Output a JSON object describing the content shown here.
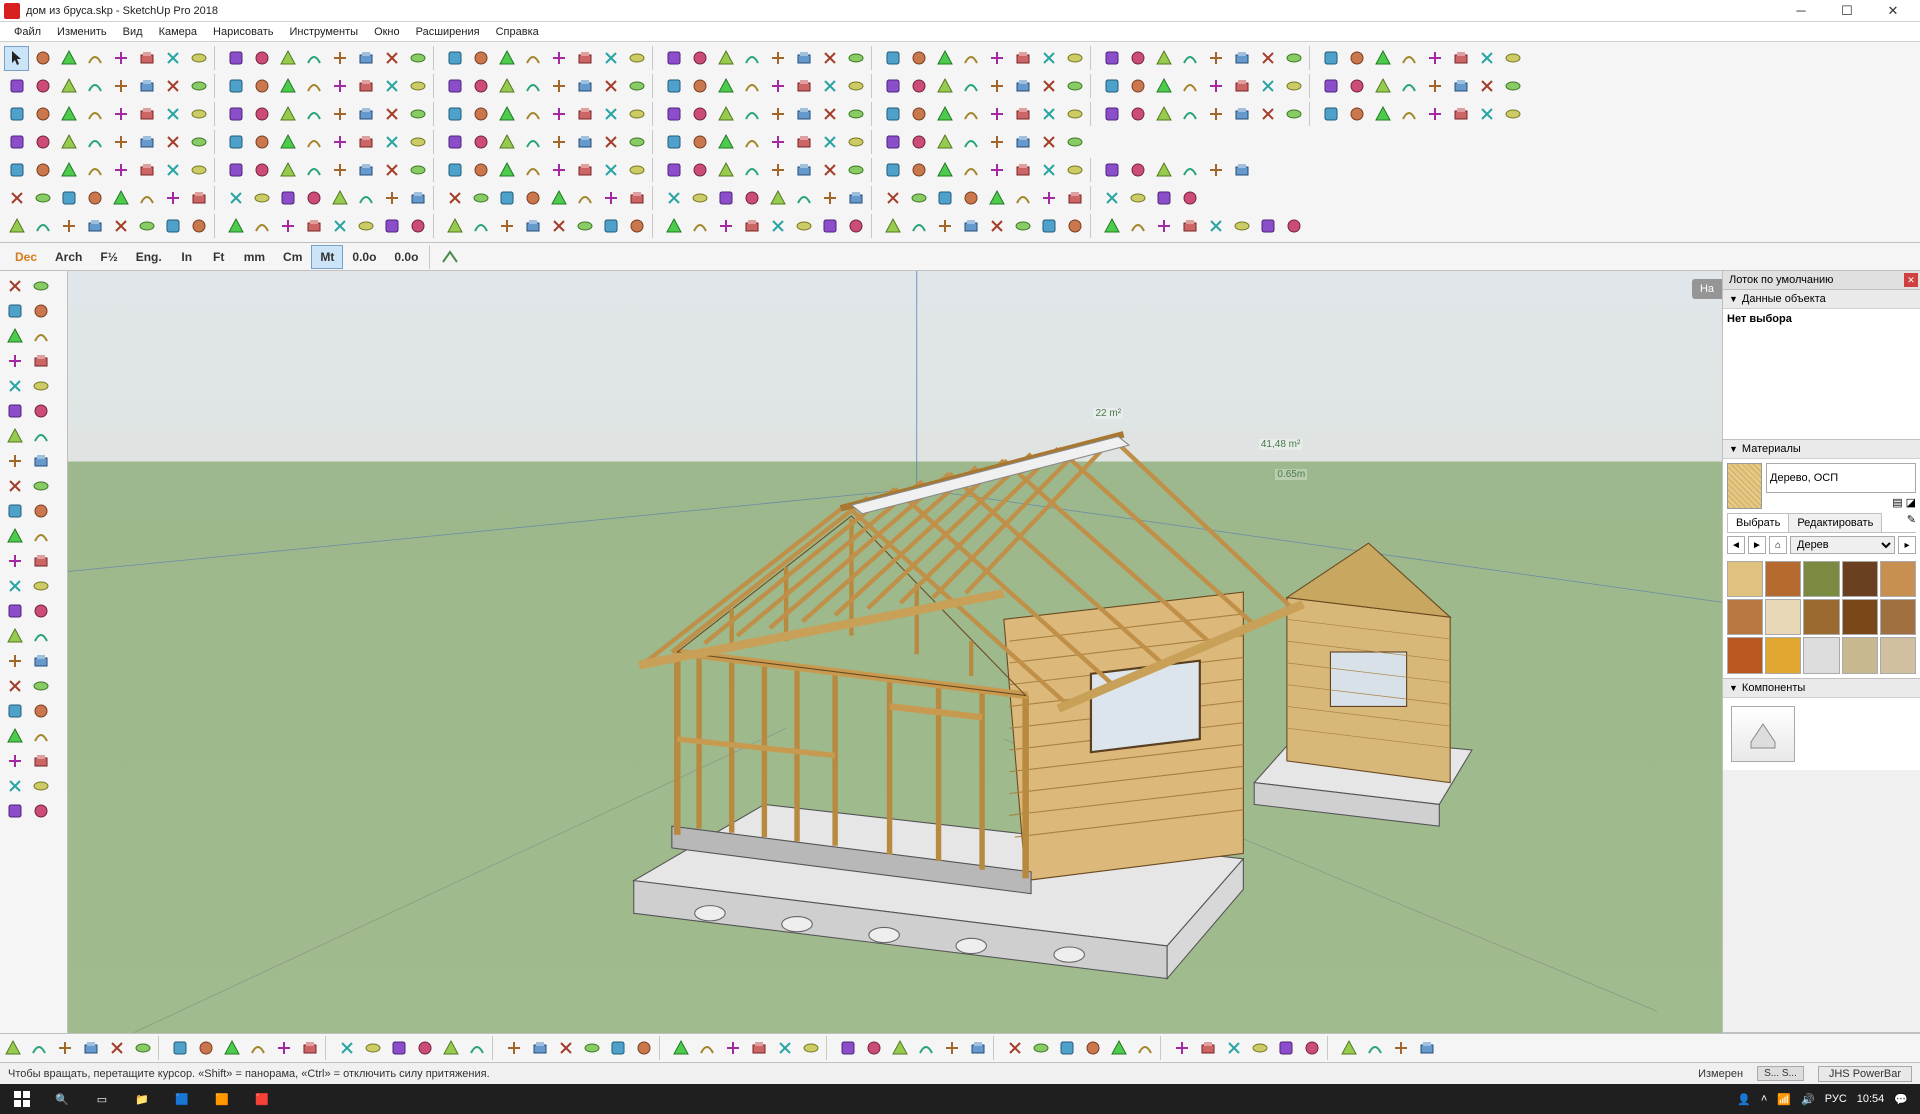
{
  "title": "дом из бруса.skp - SketchUp Pro 2018",
  "menubar": [
    "Файл",
    "Изменить",
    "Вид",
    "Камера",
    "Нарисовать",
    "Инструменты",
    "Окно",
    "Расширения",
    "Справка"
  ],
  "units_bar": {
    "items": [
      "Dec",
      "Arch",
      "F½",
      "Eng.",
      "In",
      "Ft",
      "mm",
      "Cm",
      "Mt",
      "0.0o",
      "0.0o"
    ],
    "active": "Mt"
  },
  "right_panel": {
    "tray_title": "Лоток по умолчанию",
    "entity_info": {
      "title": "Данные объекта",
      "body": "Нет выбора"
    },
    "materials": {
      "title": "Материалы",
      "current_name": "Дерево, ОСП",
      "tabs": [
        "Выбрать",
        "Редактировать"
      ],
      "active_tab": "Выбрать",
      "dropdown": "Дерев",
      "swatches": [
        "#e0c280",
        "#b56a30",
        "#7a8a40",
        "#6a4020",
        "#c89050",
        "#b87840",
        "#e8d8b8",
        "#9a6a30",
        "#7a4818",
        "#a07040",
        "#b85820",
        "#e0a830",
        "#ddd",
        "#c8b890",
        "#d0c0a0"
      ]
    },
    "components": {
      "title": "Компоненты"
    }
  },
  "statusbar": {
    "hint": "Чтобы вращать, перетащите курсор. «Shift» = панорама, «Ctrl» = отключить силу притяжения.",
    "measure_label": "Измерен",
    "powerbar": "JHS PowerBar"
  },
  "viewport": {
    "nas_label": "На",
    "annot1": "22 m²",
    "annot2": "41,48 m²",
    "annot3": "0.65m"
  },
  "taskbar": {
    "lang": "РУС",
    "time": "10:54"
  },
  "toolbar_icons": {
    "row1": [
      "cursor",
      "pencil",
      "eraser",
      "line",
      "arc1",
      "arc2",
      "rect",
      "shapes",
      "rotate1",
      "rotate2",
      "rotate3",
      "pushpull",
      "offset",
      "move-copy",
      "rotate-copy",
      "scale",
      "tape",
      "protractor",
      "text",
      "axis",
      "dim",
      "section",
      "zoom",
      "zoom-ext",
      "zoom-win",
      "orbit",
      "pan",
      "look",
      "walk",
      "position",
      "undo",
      "redo",
      "paint",
      "select-all",
      "lasso",
      "grp",
      "comp",
      "hide",
      "unhide",
      "lock",
      "eye1",
      "eye2",
      "flip1",
      "flip2",
      "flip3",
      "flip4",
      "flip5",
      "align",
      "curve1",
      "curve2",
      "curve3",
      "curve4",
      "curve5",
      "arc-a",
      "arc-b",
      "arc-c",
      "arc-d",
      "arc-e",
      "arc-f",
      "arc-g",
      "gear"
    ],
    "row2": [
      "v1",
      "v2",
      "v3",
      "v4",
      "v5",
      "v6",
      "v7",
      "poly1",
      "poly2",
      "sq1",
      "sq2",
      "sq3",
      "sq4",
      "sq5",
      "bld1",
      "bld2",
      "bld3",
      "bld4",
      "bld5",
      "bld6",
      "bld7",
      "bld8",
      "bld9",
      "bld10",
      "bld11",
      "bld12",
      "wall1",
      "wall2",
      "wall3",
      "wall4",
      "wall5",
      "wall6",
      "wall7",
      "roof1",
      "roof2",
      "roof3",
      "roof4",
      "roof5",
      "roof6",
      "roof7",
      "roof8",
      "grn1",
      "grn2",
      "grn3",
      "stair1",
      "stair2",
      "stair3",
      "circ1",
      "circ2",
      "circ3",
      "circ4",
      "circ5",
      "circ6",
      "circ7",
      "circ8",
      "sph1",
      "sph2",
      "sph3",
      "sph4",
      "sph5",
      "sph6",
      "sph7",
      "sph8",
      "sph9",
      "hand",
      "settings"
    ],
    "left_col_icons": [
      "lc1",
      "lc2",
      "lc3",
      "lc4",
      "lc5",
      "lc6",
      "lc7",
      "lc8",
      "lc9",
      "lc10",
      "lc11",
      "lc12",
      "lc13",
      "lc14",
      "lc15",
      "lc16",
      "lc17",
      "lc18",
      "lc19",
      "lc20"
    ]
  }
}
